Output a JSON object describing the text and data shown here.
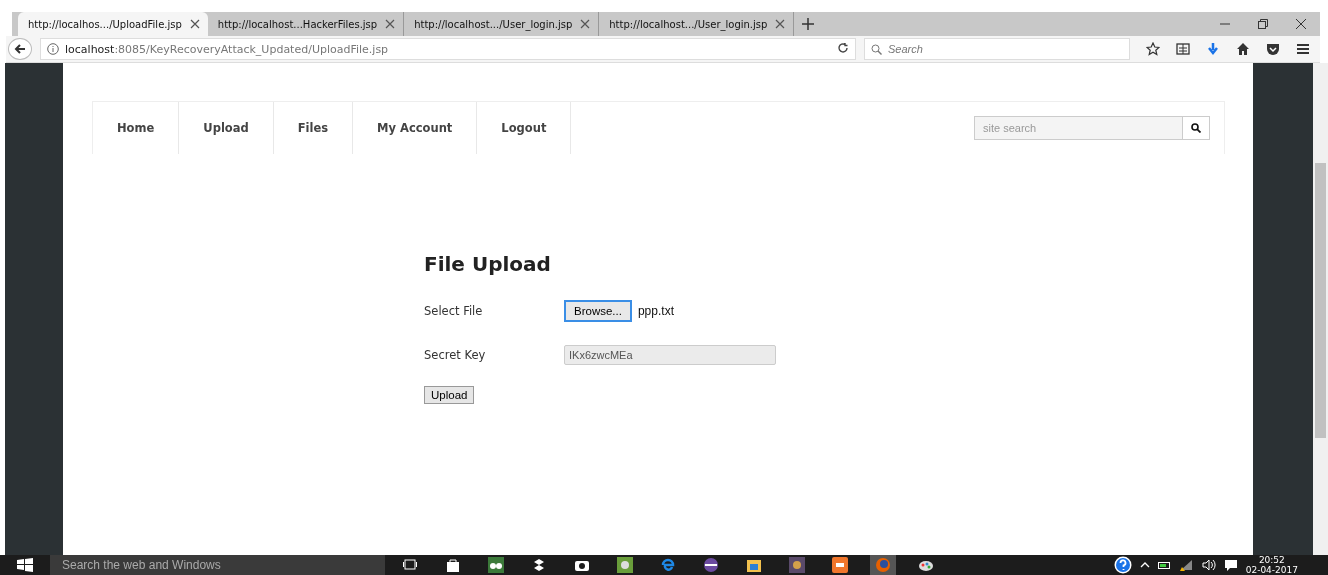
{
  "browser": {
    "tabs": [
      {
        "title": "http://localhos.../UploadFile.jsp",
        "selected": true
      },
      {
        "title": "http://localhost...HackerFiles.jsp",
        "selected": false
      },
      {
        "title": "http://localhost.../User_login.jsp",
        "selected": false
      },
      {
        "title": "http://localhost.../User_login.jsp",
        "selected": false
      }
    ],
    "url": {
      "host": "localhost",
      "rest": ":8085/KeyRecoveryAttack_Updated/UploadFile.jsp"
    },
    "search": {
      "placeholder": "Search"
    }
  },
  "nav": {
    "items": [
      "Home",
      "Upload",
      "Files",
      "My Account",
      "Logout"
    ],
    "search": {
      "placeholder": "site search"
    }
  },
  "form": {
    "title": "File Upload",
    "file_label": "Select File",
    "browse_button": "Browse...",
    "file_name": "ppp.txt",
    "key_label": "Secret Key",
    "key_value": "IKx6zwcMEa",
    "submit_button": "Upload"
  },
  "taskbar": {
    "search": {
      "placeholder": "Search the web and Windows"
    },
    "time": "20:52",
    "date": "02-04-2017"
  }
}
